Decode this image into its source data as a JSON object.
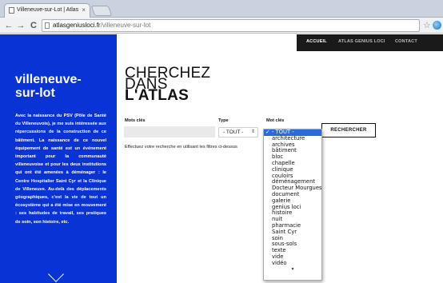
{
  "browser": {
    "tab_title": "Villeneuve-sur-Lot | Atlas",
    "tab_close": "×",
    "url_host": "atlasgeniusloci.fr",
    "url_path": "/villeneuve-sur-lot",
    "back": "←",
    "forward": "→",
    "reload": "C",
    "star": "☆"
  },
  "topnav": {
    "items": [
      "ACCUEIL",
      "ATLAS GENIUS LOCI",
      "CONTACT"
    ]
  },
  "sidebar": {
    "title_line1": "villeneuve-",
    "title_line2": "sur-lot",
    "description": "Avec la naissance du PSV (Pôle de Santé du Villeneuvois), je me suis intéressée aux répercussions de la construction de ce bâtiment. La naissance de ce nouvel équipement de santé est un événement important pour la communauté villeneuvoise et pour les deux institutions qui ont été amenées à déménager : le Centre Hospitalier Saint Cyr et la Clinique de Villeneuve. Au-delà des déplacements géographiques, c'est la vie de tout un écosystème qui a été mise en mouvement : ses habitudes de travail, ses pratiques de soin, son histoire, etc."
  },
  "heading": {
    "line1": "CHERCHEZ",
    "line2": "DANS",
    "line3": "L'ATLAS"
  },
  "search": {
    "keywords_label": "Mots clés",
    "type_label": "Type",
    "tag_label": "Mot clés",
    "type_value": "- TOUT -",
    "type_arrows": "⇕",
    "button_label": "RECHERCHER",
    "hint": "Effectuez votre recherche en utilisant les filtres ci-dessus"
  },
  "dropdown": {
    "selected": "✓ - TOUT -",
    "options": [
      "architecture",
      "archives",
      "bâtiment",
      "bloc",
      "chapelle",
      "clinique",
      "couloirs",
      "déménagement",
      "Docteur Mourgues",
      "document",
      "galerie",
      "genius loci",
      "histoire",
      "nuit",
      "pharmacie",
      "Saint Cyr",
      "soin",
      "sous-sols",
      "texte",
      "vide",
      "vidéo"
    ],
    "more_indicator": "▼"
  }
}
